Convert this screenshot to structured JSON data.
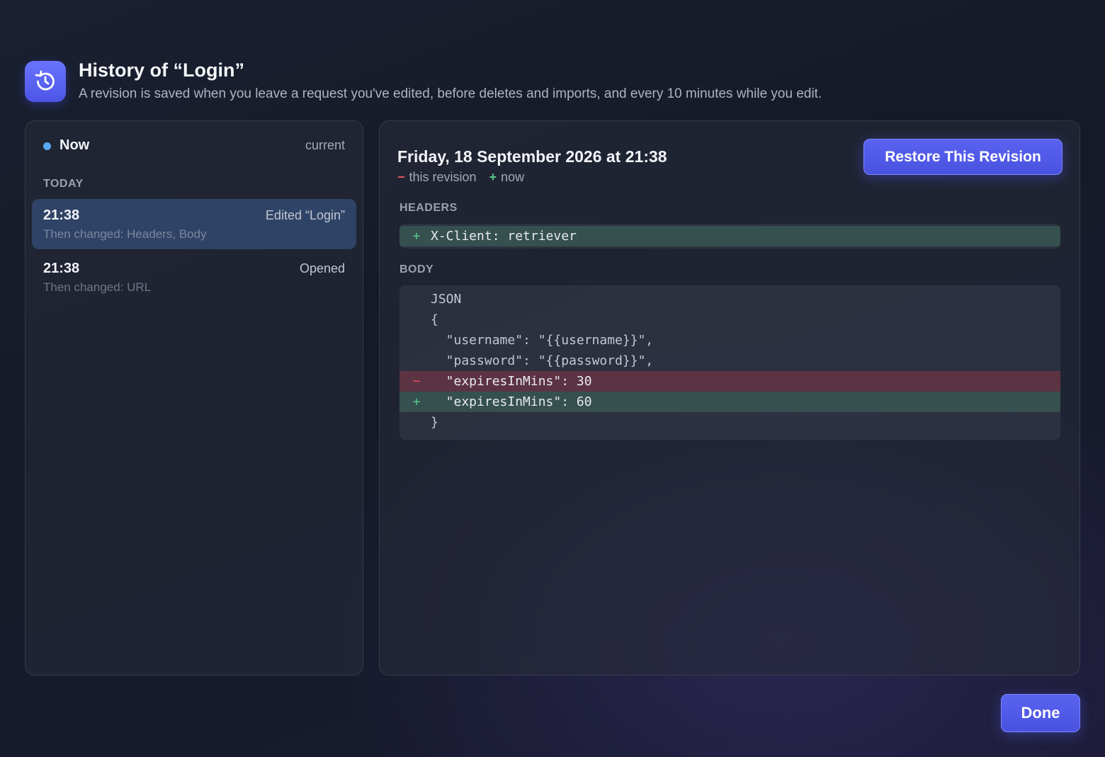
{
  "header": {
    "icon": "history-icon",
    "title": "History of “Login”",
    "subtitle": "A revision is saved when you leave a request you've edited, before deletes and imports, and every 10 minutes while you edit."
  },
  "revisions_list": {
    "now": {
      "label": "Now",
      "status": "current"
    },
    "section_today": "TODAY",
    "items": [
      {
        "time": "21:38",
        "action": "Edited “Login”",
        "changes": "Then changed: Headers, Body",
        "selected": true
      },
      {
        "time": "21:38",
        "action": "Opened",
        "changes": "Then changed: URL",
        "selected": false
      }
    ]
  },
  "detail": {
    "date": "Friday, 18 September 2026 at 21:38",
    "legend": {
      "minus_label": "this revision",
      "plus_label": "now"
    },
    "restore_label": "Restore This Revision",
    "headers_section": "HEADERS",
    "headers_lines": [
      {
        "sign": "+",
        "type": "add",
        "text": "X-Client: retriever"
      }
    ],
    "body_section": "BODY",
    "body_lines": [
      {
        "sign": "",
        "type": "ctx",
        "text": "JSON"
      },
      {
        "sign": "",
        "type": "ctx",
        "text": "{"
      },
      {
        "sign": "",
        "type": "ctx",
        "text": "  \"username\": \"{{username}}\","
      },
      {
        "sign": "",
        "type": "ctx",
        "text": "  \"password\": \"{{password}}\","
      },
      {
        "sign": "−",
        "type": "del",
        "text": "  \"expiresInMins\": 30"
      },
      {
        "sign": "+",
        "type": "add",
        "text": "  \"expiresInMins\": 60"
      },
      {
        "sign": "",
        "type": "ctx",
        "text": "}"
      }
    ]
  },
  "footer": {
    "done_label": "Done"
  },
  "colors": {
    "accent": "#5963f0",
    "selected_row": "#2f4366",
    "add": "#55c98a",
    "del": "#e0555e",
    "now_dot": "#5aa8f0"
  }
}
